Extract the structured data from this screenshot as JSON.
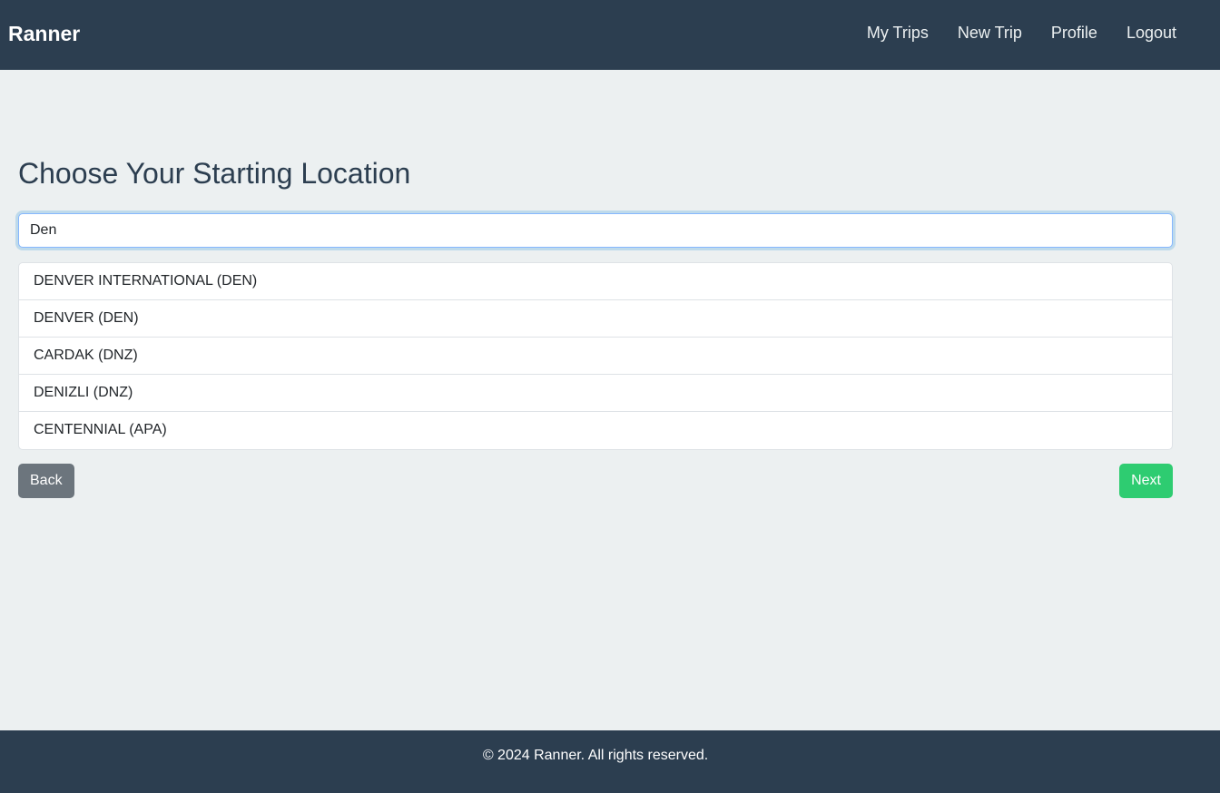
{
  "navbar": {
    "brand": "Ranner",
    "links": [
      "My Trips",
      "New Trip",
      "Profile",
      "Logout"
    ]
  },
  "main": {
    "title": "Choose Your Starting Location",
    "search": {
      "value": "Den",
      "placeholder": ""
    },
    "results": [
      "DENVER INTERNATIONAL (DEN)",
      "DENVER (DEN)",
      "CARDAK (DNZ)",
      "DENIZLI (DNZ)",
      "CENTENNIAL (APA)"
    ],
    "back_label": "Back",
    "next_label": "Next"
  },
  "footer": {
    "text": "© 2024 Ranner. All rights reserved."
  },
  "colors": {
    "navbar_bg": "#2c3e50",
    "page_bg": "#ecf0f1",
    "back_button": "#6c757d",
    "next_button": "#2ecc71"
  }
}
